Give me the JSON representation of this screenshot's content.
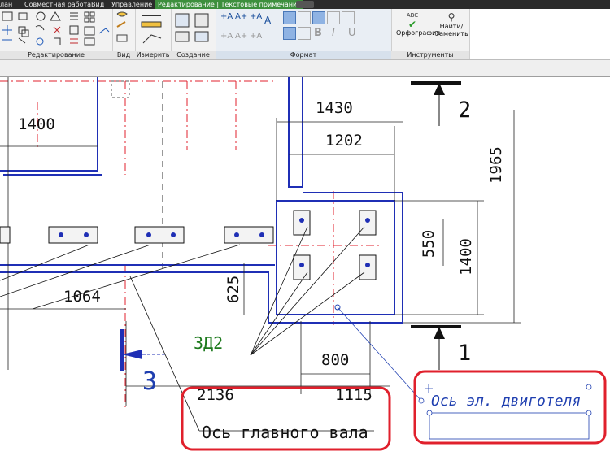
{
  "ribbon": {
    "tabs": [
      "лан",
      "Совместная работа",
      "Вид",
      "Управление",
      "Редактирование | Текстовые примечания"
    ],
    "panels": {
      "modify": "Редактирование",
      "view": "Вид",
      "measure": "Измерить",
      "create": "Создание",
      "format": "Формат",
      "tools": "Инструменты"
    },
    "format_glyphs": {
      "bold": "B",
      "italic": "I",
      "underline": "U"
    },
    "spelling": {
      "abc": "ABC",
      "label": "Орфография"
    },
    "find_replace": {
      "label_line1": "Найти/",
      "label_line2": "Заменить"
    }
  },
  "drawing": {
    "dimensions": {
      "d1400_left": "1400",
      "d1430": "1430",
      "d1202": "1202",
      "d1965": "1965",
      "d550": "550",
      "d1400_right": "1400",
      "d625": "625",
      "d1064": "1064",
      "d800": "800",
      "d2136": "2136",
      "d1115": "1115"
    },
    "section_marks": {
      "s2": "2",
      "s1": "1",
      "s3": "3"
    },
    "tag_zd2": "ЗД2",
    "note_main_shaft": "Ось главного вала",
    "note_motor_axis": "Ось эл. двиготеля"
  },
  "colors": {
    "ribbon_bg": "#f2f2f2",
    "active_tab": "#3d8f3d",
    "wall_blue": "#1f2fb5",
    "axis_red": "#e0202c",
    "highlight_red": "#e0202c",
    "tag_green": "#1d7a1d",
    "note_blue": "#1f3fb0"
  }
}
